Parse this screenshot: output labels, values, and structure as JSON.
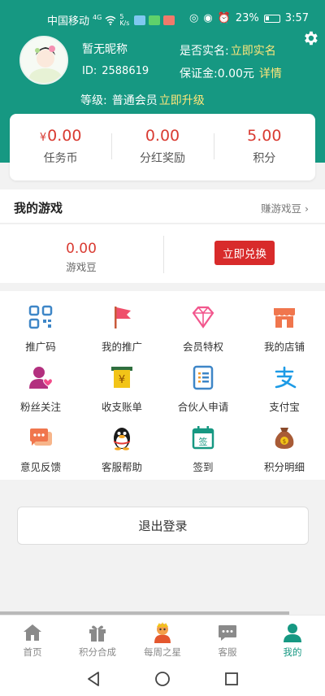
{
  "status_bar": {
    "carrier": "中国移动",
    "net": "4G",
    "speed": "5 K/s",
    "battery": "23%",
    "time": "3:57"
  },
  "profile": {
    "nickname": "暂无昵称",
    "id_label": "ID:",
    "id_value": "2588619",
    "realname_label": "是否实名:",
    "realname_link": "立即实名",
    "deposit_label": "保证金:",
    "deposit_value": "0.00元",
    "deposit_link": "详情",
    "level_label": "等级:",
    "level_value": "普通会员",
    "level_link": "立即升级"
  },
  "stats": [
    {
      "prefix": "¥",
      "value": "0.00",
      "label": "任务币"
    },
    {
      "prefix": "",
      "value": "0.00",
      "label": "分红奖励"
    },
    {
      "prefix": "",
      "value": "5.00",
      "label": "积分"
    }
  ],
  "games": {
    "title": "我的游戏",
    "more": "赚游戏豆",
    "beans_value": "0.00",
    "beans_label": "游戏豆",
    "exchange_button": "立即兑换"
  },
  "menu": [
    {
      "label": "推广码",
      "icon": "qr-code-icon"
    },
    {
      "label": "我的推广",
      "icon": "flag-icon"
    },
    {
      "label": "会员特权",
      "icon": "diamond-icon"
    },
    {
      "label": "我的店铺",
      "icon": "shop-icon"
    },
    {
      "label": "粉丝关注",
      "icon": "user-heart-icon"
    },
    {
      "label": "收支账单",
      "icon": "bill-icon"
    },
    {
      "label": "合伙人申请",
      "icon": "document-icon"
    },
    {
      "label": "支付宝",
      "icon": "alipay-icon"
    },
    {
      "label": "意见反馈",
      "icon": "chat-icon"
    },
    {
      "label": "客服帮助",
      "icon": "penguin-icon"
    },
    {
      "label": "签到",
      "icon": "calendar-sign-icon"
    },
    {
      "label": "积分明细",
      "icon": "money-bag-icon"
    }
  ],
  "logout_button": "退出登录",
  "tabs": [
    {
      "label": "首页",
      "icon": "home-icon"
    },
    {
      "label": "积分合成",
      "icon": "gift-icon"
    },
    {
      "label": "每周之星",
      "icon": "star-character-icon"
    },
    {
      "label": "客服",
      "icon": "message-icon"
    },
    {
      "label": "我的",
      "icon": "person-icon",
      "active": true
    }
  ],
  "colors": {
    "brand": "#169882",
    "accent_red": "#d82b2b",
    "link_yellow": "#ffe67a"
  }
}
